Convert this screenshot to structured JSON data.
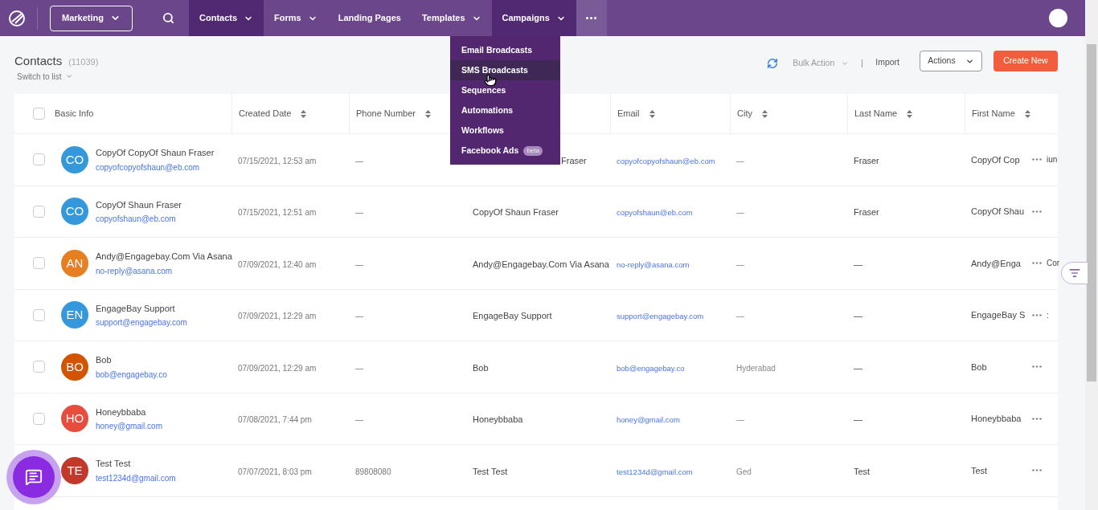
{
  "topbar": {
    "workspace": "Marketing",
    "nav": [
      {
        "label": "Contacts",
        "dropdown": true,
        "selected": true
      },
      {
        "label": "Forms",
        "dropdown": true,
        "selected": false
      },
      {
        "label": "Landing Pages",
        "dropdown": false,
        "selected": false
      },
      {
        "label": "Templates",
        "dropdown": true,
        "selected": false
      },
      {
        "label": "Campaigns",
        "dropdown": true,
        "selected": true
      }
    ]
  },
  "campaigns_menu": [
    {
      "label": "Email Broadcasts",
      "selected": false
    },
    {
      "label": "SMS Broadcasts",
      "selected": true
    },
    {
      "label": "Sequences",
      "selected": false
    },
    {
      "label": "Automations",
      "selected": false
    },
    {
      "label": "Workflows",
      "selected": false
    },
    {
      "label": "Facebook Ads",
      "badge": "beta",
      "selected": false
    }
  ],
  "header": {
    "title": "Contacts",
    "count": "(11039)",
    "switch": "Switch to list",
    "bulk_action": "Bulk Action",
    "import": "Import",
    "actions": "Actions",
    "create": "Create New"
  },
  "select_all_checked": false,
  "columns": [
    {
      "label": "Basic Info",
      "sortable": false
    },
    {
      "label": "Created Date",
      "sortable": true
    },
    {
      "label": "Phone Number",
      "sortable": true
    },
    {
      "label": "Email",
      "sortable": true
    },
    {
      "label": "City",
      "sortable": true
    },
    {
      "label": "Last Name",
      "sortable": true
    },
    {
      "label": "First Name",
      "sortable": true
    }
  ],
  "rows": [
    {
      "initials": "CO",
      "color": "#3498db",
      "name": "CopyOf CopyOf Shaun Fraser",
      "email": "copyofcopyofshaun@eb.com",
      "checked": false,
      "created": "07/15/2021, 12:53 am",
      "phone": "—",
      "full_name": "Fraser",
      "full_name_covered": true,
      "email_2": "copyofcopyofshaun@eb.com",
      "city": "—",
      "last_name": "Fraser",
      "first_name": "CopyOf Cop",
      "overflow": "iun"
    },
    {
      "initials": "CO",
      "color": "#3498db",
      "name": "CopyOf Shaun Fraser",
      "email": "copyofshaun@eb.com",
      "checked": false,
      "created": "07/15/2021, 12:51 am",
      "phone": "—",
      "full_name": "CopyOf Shaun Fraser",
      "email_2": "copyofshaun@eb.com",
      "city": "—",
      "last_name": "Fraser",
      "first_name": "CopyOf Shau"
    },
    {
      "initials": "AN",
      "color": "#e67e22",
      "name": "Andy@Engagebay.Com Via Asana",
      "email": "no-reply@asana.com",
      "checked": false,
      "created": "07/09/2021, 12:40 am",
      "phone": "—",
      "full_name": "Andy@Engagebay.Com Via Asana",
      "email_2": "no-reply@asana.com",
      "city": "—",
      "last_name": "—",
      "first_name": "Andy@Enga",
      "overflow": "Cor"
    },
    {
      "initials": "EN",
      "color": "#3498db",
      "name": "EngageBay Support",
      "email": "support@engagebay.com",
      "checked": false,
      "created": "07/09/2021, 12:29 am",
      "phone": "—",
      "full_name": "EngageBay Support",
      "email_2": "support@engagebay.com",
      "city": "—",
      "last_name": "—",
      "first_name": "EngageBay S",
      "overflow": ":"
    },
    {
      "initials": "BO",
      "color": "#d35400",
      "name": "Bob",
      "email": "bob@engagebay.co",
      "checked": false,
      "created": "07/09/2021, 12:29 am",
      "phone": "—",
      "full_name": "Bob",
      "email_2": "bob@engagebay.co",
      "city": "Hyderabad",
      "last_name": "—",
      "first_name": "Bob"
    },
    {
      "initials": "HO",
      "color": "#e74c3c",
      "name": "Honeybbaba",
      "email": "honey@gmail.com",
      "checked": false,
      "created": "07/08/2021, 7:44 pm",
      "phone": "—",
      "full_name": "Honeybbaba",
      "email_2": "honey@gmail.com",
      "city": "—",
      "last_name": "—",
      "first_name": "Honeybbaba"
    },
    {
      "initials": "TE",
      "color": "#c0392b",
      "name": "Test Test",
      "email": "test1234d@gmail.com",
      "created": "07/07/2021, 8:03 pm",
      "phone": "89808080",
      "full_name": "Test Test",
      "email_2": "test1234d@gmail.com",
      "city": "Ged",
      "last_name": "Test",
      "first_name": "Test"
    }
  ]
}
